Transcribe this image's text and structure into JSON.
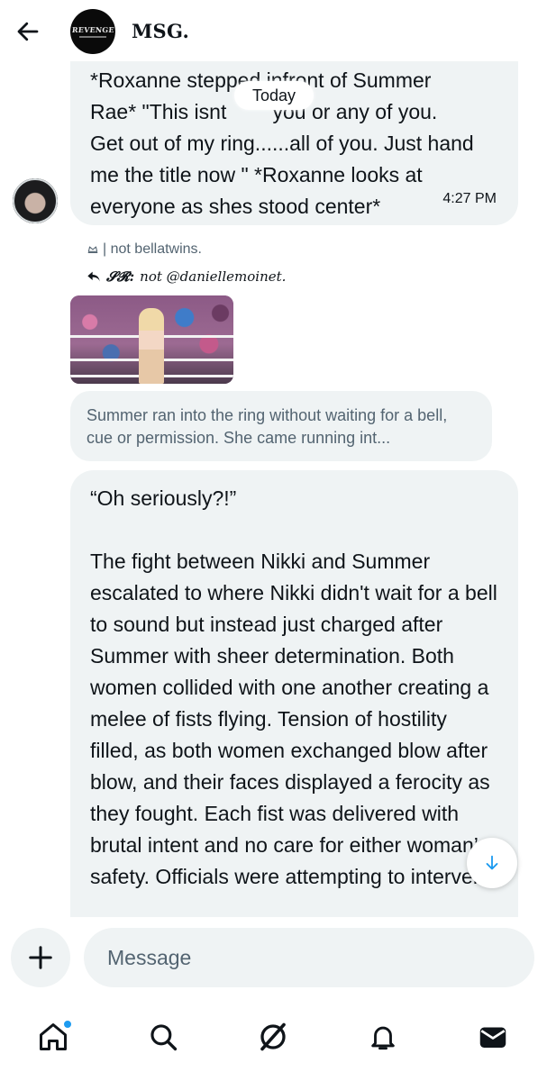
{
  "header": {
    "title": "MSG.",
    "avatar_logo_text": "REVENGE"
  },
  "date_divider": "Today",
  "messages": [
    {
      "text": "*Roxanne stepped infront of Summer Rae* \"This isnt about you or any of you. Get out of my ring......all of you. Just hand me the title now \" *Roxanne looks at everyone as shes stood center*",
      "visible_text_line1": "*Roxanne stepped infront of Summer",
      "visible_text_line2": "Rae* \"This isnt",
      "visible_text_line2_tail": "you or any of you.",
      "visible_text_rest": "Get out of my ring......all of you. Just hand\nme the title now \" *Roxanne looks at\neveryone as shes stood center*",
      "time": "4:27 PM"
    },
    {
      "quote_meta": "| not bellatwins.",
      "reply_prefix": "𝓢𝓡:",
      "reply_text": "not @daniellemoinet.",
      "quoted_preview": "Summer ran into the ring without waiting for a bell, cue or permission. She came running int...",
      "text": "“Oh seriously?!”\n\nThe fight between Nikki and Summer escalated to where Nikki didn't wait for a bell to sound but instead just charged after Summer with sheer determination. Both women collided with one another creating a melee of fists flying. Tension of hostility filled, as both women exchanged blow after blow, and their faces displayed a ferocity as they fought. Each fist was delivered with brutal intent and no care for either woman’s safety. Officials were attempting to intervene"
    }
  ],
  "composer": {
    "placeholder": "Message"
  },
  "icons": {
    "back": "arrow-left-icon",
    "plus": "plus-icon",
    "scroll_down": "arrow-down-icon",
    "tabs": [
      "home-icon",
      "search-icon",
      "grok-icon",
      "bell-icon",
      "envelope-icon"
    ]
  },
  "colors": {
    "bubble": "#eff3f4",
    "accent": "#1d9bf0",
    "secondary_text": "#536471"
  }
}
